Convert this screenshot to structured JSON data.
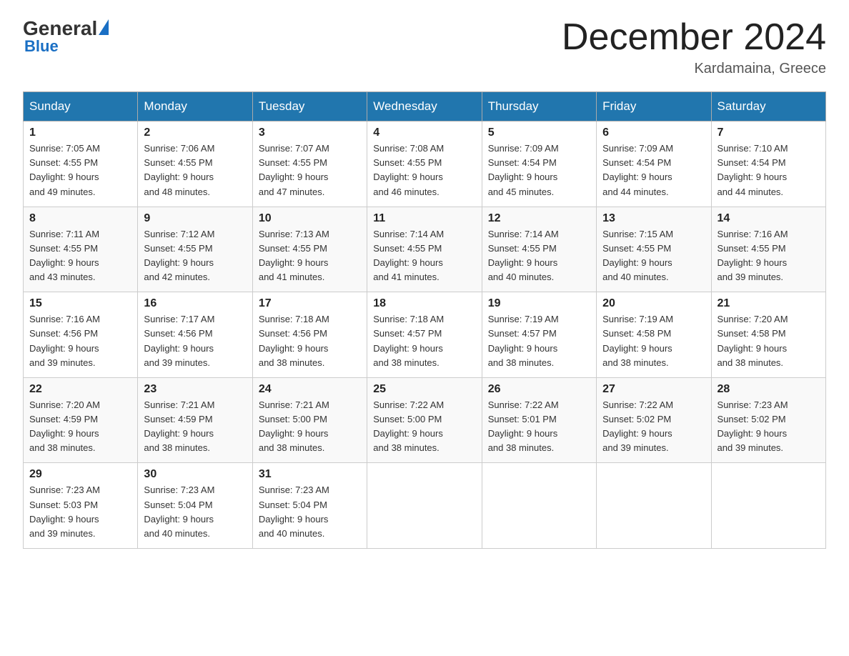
{
  "header": {
    "logo_general": "General",
    "logo_blue": "Blue",
    "title": "December 2024",
    "location": "Kardamaina, Greece"
  },
  "weekdays": [
    "Sunday",
    "Monday",
    "Tuesday",
    "Wednesday",
    "Thursday",
    "Friday",
    "Saturday"
  ],
  "weeks": [
    [
      {
        "day": "1",
        "sunrise": "7:05 AM",
        "sunset": "4:55 PM",
        "daylight": "9 hours and 49 minutes."
      },
      {
        "day": "2",
        "sunrise": "7:06 AM",
        "sunset": "4:55 PM",
        "daylight": "9 hours and 48 minutes."
      },
      {
        "day": "3",
        "sunrise": "7:07 AM",
        "sunset": "4:55 PM",
        "daylight": "9 hours and 47 minutes."
      },
      {
        "day": "4",
        "sunrise": "7:08 AM",
        "sunset": "4:55 PM",
        "daylight": "9 hours and 46 minutes."
      },
      {
        "day": "5",
        "sunrise": "7:09 AM",
        "sunset": "4:54 PM",
        "daylight": "9 hours and 45 minutes."
      },
      {
        "day": "6",
        "sunrise": "7:09 AM",
        "sunset": "4:54 PM",
        "daylight": "9 hours and 44 minutes."
      },
      {
        "day": "7",
        "sunrise": "7:10 AM",
        "sunset": "4:54 PM",
        "daylight": "9 hours and 44 minutes."
      }
    ],
    [
      {
        "day": "8",
        "sunrise": "7:11 AM",
        "sunset": "4:55 PM",
        "daylight": "9 hours and 43 minutes."
      },
      {
        "day": "9",
        "sunrise": "7:12 AM",
        "sunset": "4:55 PM",
        "daylight": "9 hours and 42 minutes."
      },
      {
        "day": "10",
        "sunrise": "7:13 AM",
        "sunset": "4:55 PM",
        "daylight": "9 hours and 41 minutes."
      },
      {
        "day": "11",
        "sunrise": "7:14 AM",
        "sunset": "4:55 PM",
        "daylight": "9 hours and 41 minutes."
      },
      {
        "day": "12",
        "sunrise": "7:14 AM",
        "sunset": "4:55 PM",
        "daylight": "9 hours and 40 minutes."
      },
      {
        "day": "13",
        "sunrise": "7:15 AM",
        "sunset": "4:55 PM",
        "daylight": "9 hours and 40 minutes."
      },
      {
        "day": "14",
        "sunrise": "7:16 AM",
        "sunset": "4:55 PM",
        "daylight": "9 hours and 39 minutes."
      }
    ],
    [
      {
        "day": "15",
        "sunrise": "7:16 AM",
        "sunset": "4:56 PM",
        "daylight": "9 hours and 39 minutes."
      },
      {
        "day": "16",
        "sunrise": "7:17 AM",
        "sunset": "4:56 PM",
        "daylight": "9 hours and 39 minutes."
      },
      {
        "day": "17",
        "sunrise": "7:18 AM",
        "sunset": "4:56 PM",
        "daylight": "9 hours and 38 minutes."
      },
      {
        "day": "18",
        "sunrise": "7:18 AM",
        "sunset": "4:57 PM",
        "daylight": "9 hours and 38 minutes."
      },
      {
        "day": "19",
        "sunrise": "7:19 AM",
        "sunset": "4:57 PM",
        "daylight": "9 hours and 38 minutes."
      },
      {
        "day": "20",
        "sunrise": "7:19 AM",
        "sunset": "4:58 PM",
        "daylight": "9 hours and 38 minutes."
      },
      {
        "day": "21",
        "sunrise": "7:20 AM",
        "sunset": "4:58 PM",
        "daylight": "9 hours and 38 minutes."
      }
    ],
    [
      {
        "day": "22",
        "sunrise": "7:20 AM",
        "sunset": "4:59 PM",
        "daylight": "9 hours and 38 minutes."
      },
      {
        "day": "23",
        "sunrise": "7:21 AM",
        "sunset": "4:59 PM",
        "daylight": "9 hours and 38 minutes."
      },
      {
        "day": "24",
        "sunrise": "7:21 AM",
        "sunset": "5:00 PM",
        "daylight": "9 hours and 38 minutes."
      },
      {
        "day": "25",
        "sunrise": "7:22 AM",
        "sunset": "5:00 PM",
        "daylight": "9 hours and 38 minutes."
      },
      {
        "day": "26",
        "sunrise": "7:22 AM",
        "sunset": "5:01 PM",
        "daylight": "9 hours and 38 minutes."
      },
      {
        "day": "27",
        "sunrise": "7:22 AM",
        "sunset": "5:02 PM",
        "daylight": "9 hours and 39 minutes."
      },
      {
        "day": "28",
        "sunrise": "7:23 AM",
        "sunset": "5:02 PM",
        "daylight": "9 hours and 39 minutes."
      }
    ],
    [
      {
        "day": "29",
        "sunrise": "7:23 AM",
        "sunset": "5:03 PM",
        "daylight": "9 hours and 39 minutes."
      },
      {
        "day": "30",
        "sunrise": "7:23 AM",
        "sunset": "5:04 PM",
        "daylight": "9 hours and 40 minutes."
      },
      {
        "day": "31",
        "sunrise": "7:23 AM",
        "sunset": "5:04 PM",
        "daylight": "9 hours and 40 minutes."
      },
      null,
      null,
      null,
      null
    ]
  ],
  "sunrise_label": "Sunrise:",
  "sunset_label": "Sunset:",
  "daylight_label": "Daylight:"
}
